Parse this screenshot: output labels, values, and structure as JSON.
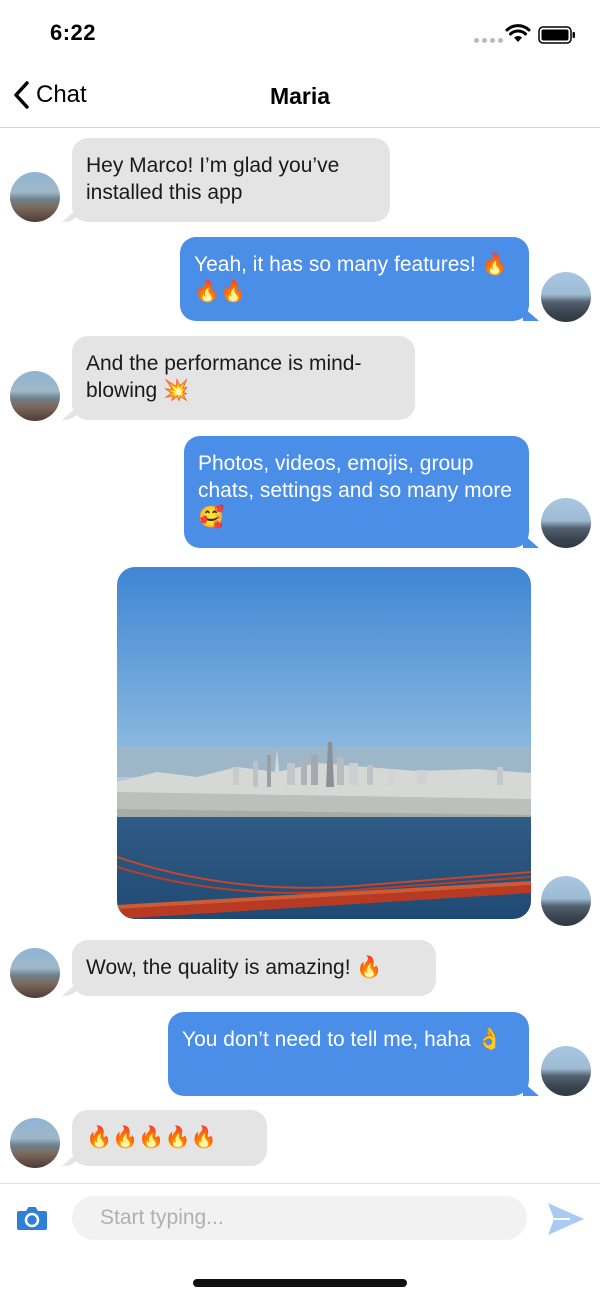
{
  "status": {
    "time": "6:22"
  },
  "nav": {
    "back_label": "Chat",
    "title": "Maria"
  },
  "messages": [
    {
      "from": "Maria",
      "text": "Hey Marco! I’m glad you’ve installed this app"
    },
    {
      "from": "Marco",
      "text": "Yeah, it has so many features! 🔥🔥🔥"
    },
    {
      "from": "Maria",
      "text": "And the performance is mind-blowing 💥"
    },
    {
      "from": "Marco",
      "text": "Photos, videos, emojis, group chats, settings and so many more 🥰"
    },
    {
      "from": "Marco",
      "type": "image"
    },
    {
      "from": "Maria",
      "text": "Wow, the quality is amazing! 🔥"
    },
    {
      "from": "Marco",
      "text": "You don’t need to tell me, haha 👌"
    },
    {
      "from": "Maria",
      "text": "🔥🔥🔥🔥🔥"
    }
  ],
  "composer": {
    "placeholder": "Start typing..."
  },
  "colors": {
    "outgoing_bubble": "#4a8ee8",
    "incoming_bubble": "#e4e4e4",
    "accent": "#2f7fd8"
  },
  "icons": {
    "back": "chevron-left-icon",
    "camera": "camera-icon",
    "send": "send-icon"
  }
}
